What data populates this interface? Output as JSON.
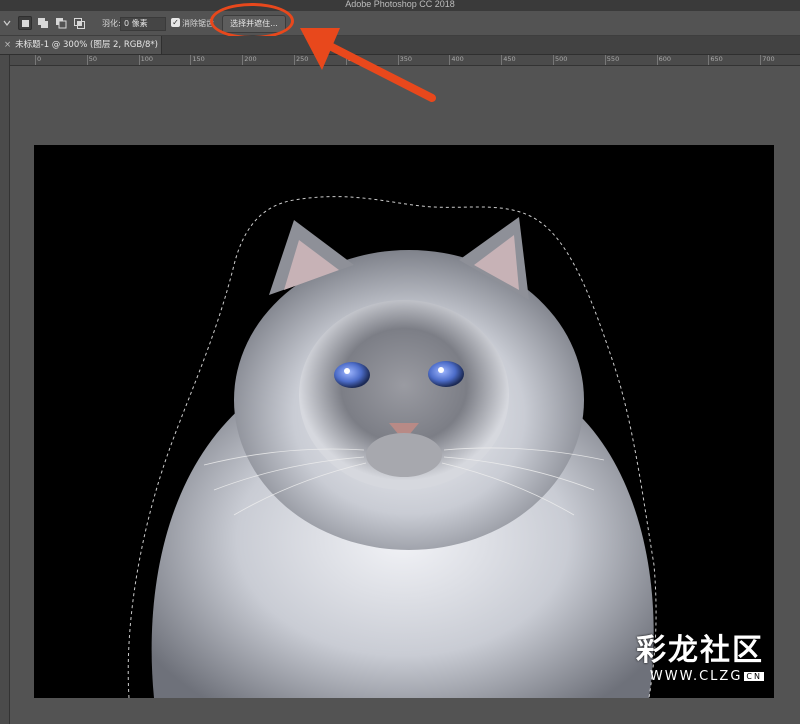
{
  "app_title": "Adobe Photoshop CC 2018",
  "options": {
    "feather_label": "羽化:",
    "feather_value": "0 像素",
    "antialias_label": "消除锯齿",
    "antialias_checked": "✓",
    "select_mask_label": "选择并遮住..."
  },
  "document_tab": {
    "close": "×",
    "label": "未标题-1 @ 300% (图层 2, RGB/8*) *"
  },
  "ruler": {
    "h_labels": [
      "0",
      "50",
      "100",
      "150",
      "200",
      "250",
      "300",
      "350",
      "400",
      "450",
      "500",
      "550",
      "600",
      "650",
      "700"
    ]
  },
  "watermark": {
    "chinese": "彩龙社区",
    "url": "WWW.CLZG",
    "suffix": "CN"
  },
  "colors": {
    "accent_annotation": "#e8481c",
    "panel": "#535353",
    "canvas_bg": "#000000"
  },
  "icons": [
    "new-selection-icon",
    "add-to-selection-icon",
    "subtract-from-selection-icon",
    "intersect-selection-icon",
    "tool-dropdown-icon"
  ]
}
